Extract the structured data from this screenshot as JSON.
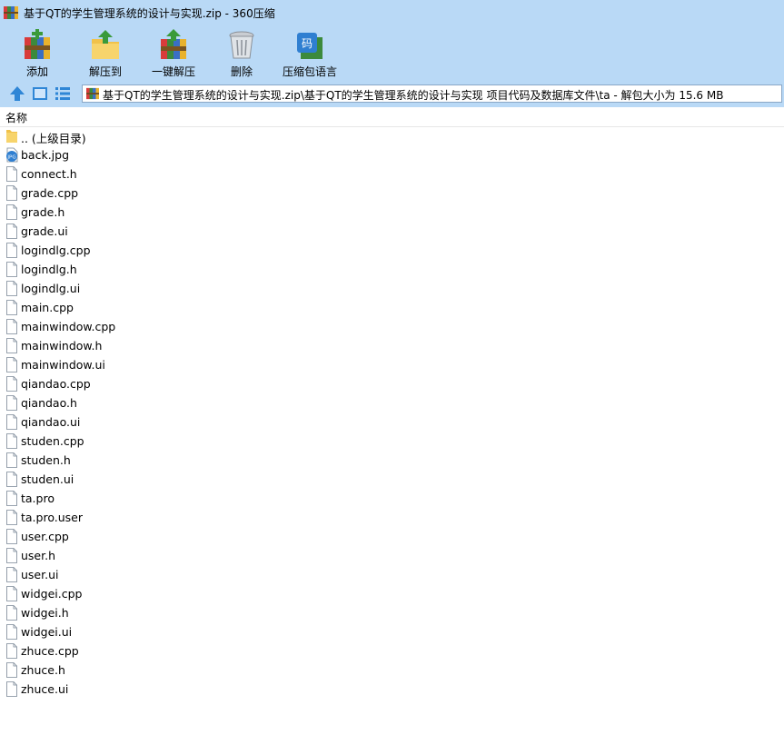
{
  "window": {
    "title": "基于QT的学生管理系统的设计与实现.zip - 360压缩"
  },
  "toolbar": {
    "items": [
      {
        "label": "添加",
        "icon": "add-archive-icon"
      },
      {
        "label": "解压到",
        "icon": "extract-to-icon"
      },
      {
        "label": "一键解压",
        "icon": "one-click-extract-icon"
      },
      {
        "label": "删除",
        "icon": "delete-trash-icon"
      },
      {
        "label": "压缩包语言",
        "icon": "archive-language-icon"
      }
    ]
  },
  "addressbar": {
    "path": "基于QT的学生管理系统的设计与实现.zip\\基于QT的学生管理系统的设计与实现 项目代码及数据库文件\\ta - 解包大小为 15.6 MB"
  },
  "list": {
    "column_header": "名称",
    "parent": ".. (上级目录)",
    "files": [
      {
        "name": "back.jpg",
        "type": "image"
      },
      {
        "name": "connect.h",
        "type": "file"
      },
      {
        "name": "grade.cpp",
        "type": "file"
      },
      {
        "name": "grade.h",
        "type": "file"
      },
      {
        "name": "grade.ui",
        "type": "file"
      },
      {
        "name": "logindlg.cpp",
        "type": "file"
      },
      {
        "name": "logindlg.h",
        "type": "file"
      },
      {
        "name": "logindlg.ui",
        "type": "file"
      },
      {
        "name": "main.cpp",
        "type": "file"
      },
      {
        "name": "mainwindow.cpp",
        "type": "file"
      },
      {
        "name": "mainwindow.h",
        "type": "file"
      },
      {
        "name": "mainwindow.ui",
        "type": "file"
      },
      {
        "name": "qiandao.cpp",
        "type": "file"
      },
      {
        "name": "qiandao.h",
        "type": "file"
      },
      {
        "name": "qiandao.ui",
        "type": "file"
      },
      {
        "name": "studen.cpp",
        "type": "file"
      },
      {
        "name": "studen.h",
        "type": "file"
      },
      {
        "name": "studen.ui",
        "type": "file"
      },
      {
        "name": "ta.pro",
        "type": "file"
      },
      {
        "name": "ta.pro.user",
        "type": "file"
      },
      {
        "name": "user.cpp",
        "type": "file"
      },
      {
        "name": "user.h",
        "type": "file"
      },
      {
        "name": "user.ui",
        "type": "file"
      },
      {
        "name": "widgei.cpp",
        "type": "file"
      },
      {
        "name": "widgei.h",
        "type": "file"
      },
      {
        "name": "widgei.ui",
        "type": "file"
      },
      {
        "name": "zhuce.cpp",
        "type": "file"
      },
      {
        "name": "zhuce.h",
        "type": "file"
      },
      {
        "name": "zhuce.ui",
        "type": "file"
      }
    ]
  },
  "colors": {
    "chrome": "#b9d9f6",
    "folder": "#f7d46c"
  }
}
